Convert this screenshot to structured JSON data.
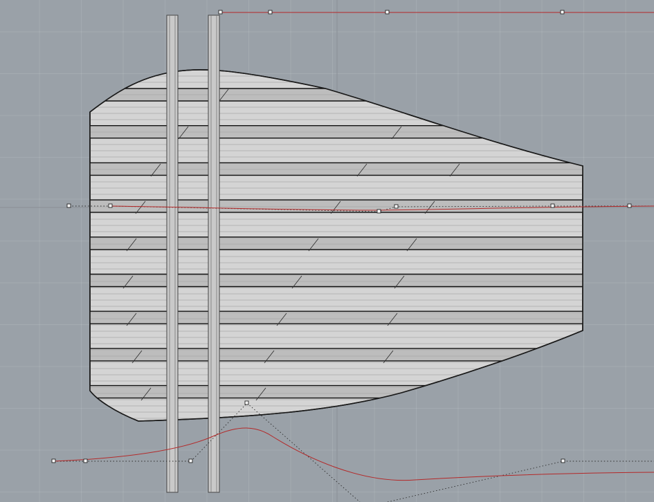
{
  "viewport": {
    "background": "#9aa1a8",
    "grid_color": "#b3b8bd",
    "view": "Top"
  },
  "model": {
    "hull_fill": "#d4d4d4",
    "hull_stroke": "#1a1a1a",
    "plank_band_color": "#bdbdbd",
    "rail_color": "#c9c9c9"
  },
  "curves": {
    "color": "#b42828",
    "count": 3
  },
  "control_points": {
    "fill": "#ffffff",
    "stroke": "#222222"
  }
}
